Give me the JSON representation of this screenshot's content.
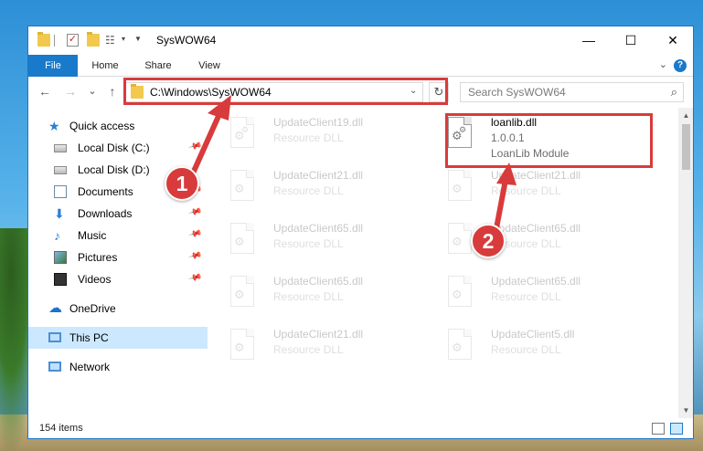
{
  "window": {
    "title": "SysWOW64",
    "minimize_glyph": "—",
    "maximize_glyph": "☐",
    "close_glyph": "✕"
  },
  "ribbon": {
    "tabs": [
      {
        "label": "File",
        "active": true
      },
      {
        "label": "Home"
      },
      {
        "label": "Share"
      },
      {
        "label": "View"
      }
    ],
    "help_glyph": "?"
  },
  "navbar": {
    "back_glyph": "←",
    "forward_glyph": "→",
    "recent_glyph": "⌄",
    "up_glyph": "↑",
    "address": "C:\\Windows\\SysWOW64",
    "address_drop_glyph": "⌄",
    "refresh_glyph": "↻",
    "search_placeholder": "Search SysWOW64",
    "search_glyph": "⌕"
  },
  "sidebar": {
    "quick_access": "Quick access",
    "items": [
      {
        "label": "Local Disk (C:)",
        "icon": "drive-icon"
      },
      {
        "label": "Local Disk (D:)",
        "icon": "drive-icon"
      },
      {
        "label": "Documents",
        "icon": "documents-icon"
      },
      {
        "label": "Downloads",
        "icon": "downloads-icon"
      },
      {
        "label": "Music",
        "icon": "music-icon"
      },
      {
        "label": "Pictures",
        "icon": "pictures-icon"
      },
      {
        "label": "Videos",
        "icon": "videos-icon"
      }
    ],
    "onedrive": "OneDrive",
    "this_pc": "This PC",
    "network": "Network"
  },
  "files": [
    {
      "name": "UpdateClient19.dll",
      "type": "Resource DLL",
      "faded": true
    },
    {
      "name": "loanlib.dll",
      "type": "1.0.0.1",
      "desc": "LoanLib Module",
      "faded": false
    },
    {
      "name": "UpdateClient21.dll",
      "type": "Resource DLL",
      "faded": true
    },
    {
      "name": "UpdateClient21.dll",
      "type": "Resource DLL",
      "faded": true
    },
    {
      "name": "UpdateClient65.dll",
      "type": "Resource DLL",
      "faded": true
    },
    {
      "name": "UpdateClient65.dll",
      "type": "Resource DLL",
      "faded": true
    },
    {
      "name": "UpdateClient65.dll",
      "type": "Resource DLL",
      "faded": true
    },
    {
      "name": "UpdateClient65.dll",
      "type": "Resource DLL",
      "faded": true
    },
    {
      "name": "UpdateClient21.dll",
      "type": "Resource DLL",
      "faded": true
    },
    {
      "name": "UpdateClient5.dll",
      "type": "Resource DLL",
      "faded": true
    }
  ],
  "status": {
    "item_count": "154 items"
  },
  "annotations": {
    "badge_1": "1",
    "badge_2": "2",
    "accent_color": "#d83b3b"
  },
  "colors": {
    "accent": "#1979ca",
    "selection": "#cce8ff"
  }
}
